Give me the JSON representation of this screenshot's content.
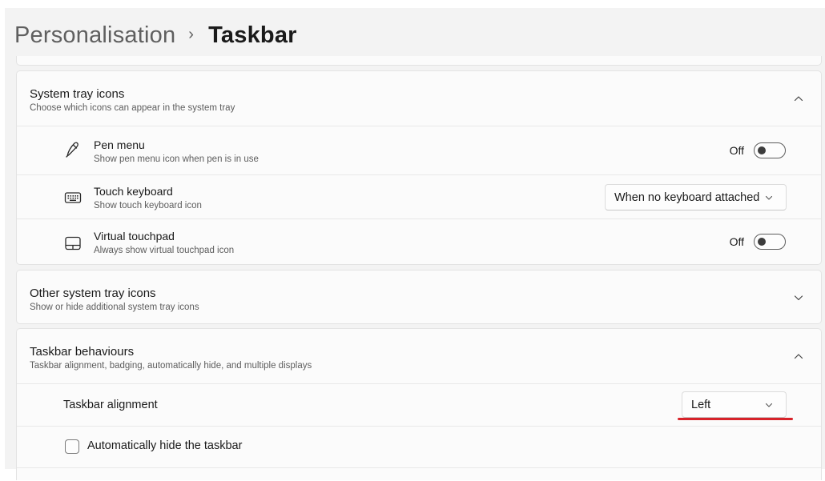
{
  "breadcrumb": {
    "parent": "Personalisation",
    "separator": "›",
    "current": "Taskbar"
  },
  "system_tray": {
    "title": "System tray icons",
    "description": "Choose which icons can appear in the system tray",
    "expanded": true,
    "items": [
      {
        "icon": "pen-icon",
        "title": "Pen menu",
        "description": "Show pen menu icon when pen is in use",
        "control": "toggle",
        "state_label": "Off"
      },
      {
        "icon": "keyboard-icon",
        "title": "Touch keyboard",
        "description": "Show touch keyboard icon",
        "control": "dropdown",
        "value": "When no keyboard attached"
      },
      {
        "icon": "touchpad-icon",
        "title": "Virtual touchpad",
        "description": "Always show virtual touchpad icon",
        "control": "toggle",
        "state_label": "Off"
      }
    ]
  },
  "other_tray": {
    "title": "Other system tray icons",
    "description": "Show or hide additional system tray icons",
    "expanded": false
  },
  "behaviours": {
    "title": "Taskbar behaviours",
    "description": "Taskbar alignment, badging, automatically hide, and multiple displays",
    "expanded": true,
    "alignment": {
      "label": "Taskbar alignment",
      "value": "Left"
    },
    "auto_hide": {
      "label": "Automatically hide the taskbar",
      "checked": false
    }
  },
  "colors": {
    "background": "#f3f3f3",
    "card": "#fbfbfb",
    "annotation_underline": "#d8232a"
  }
}
